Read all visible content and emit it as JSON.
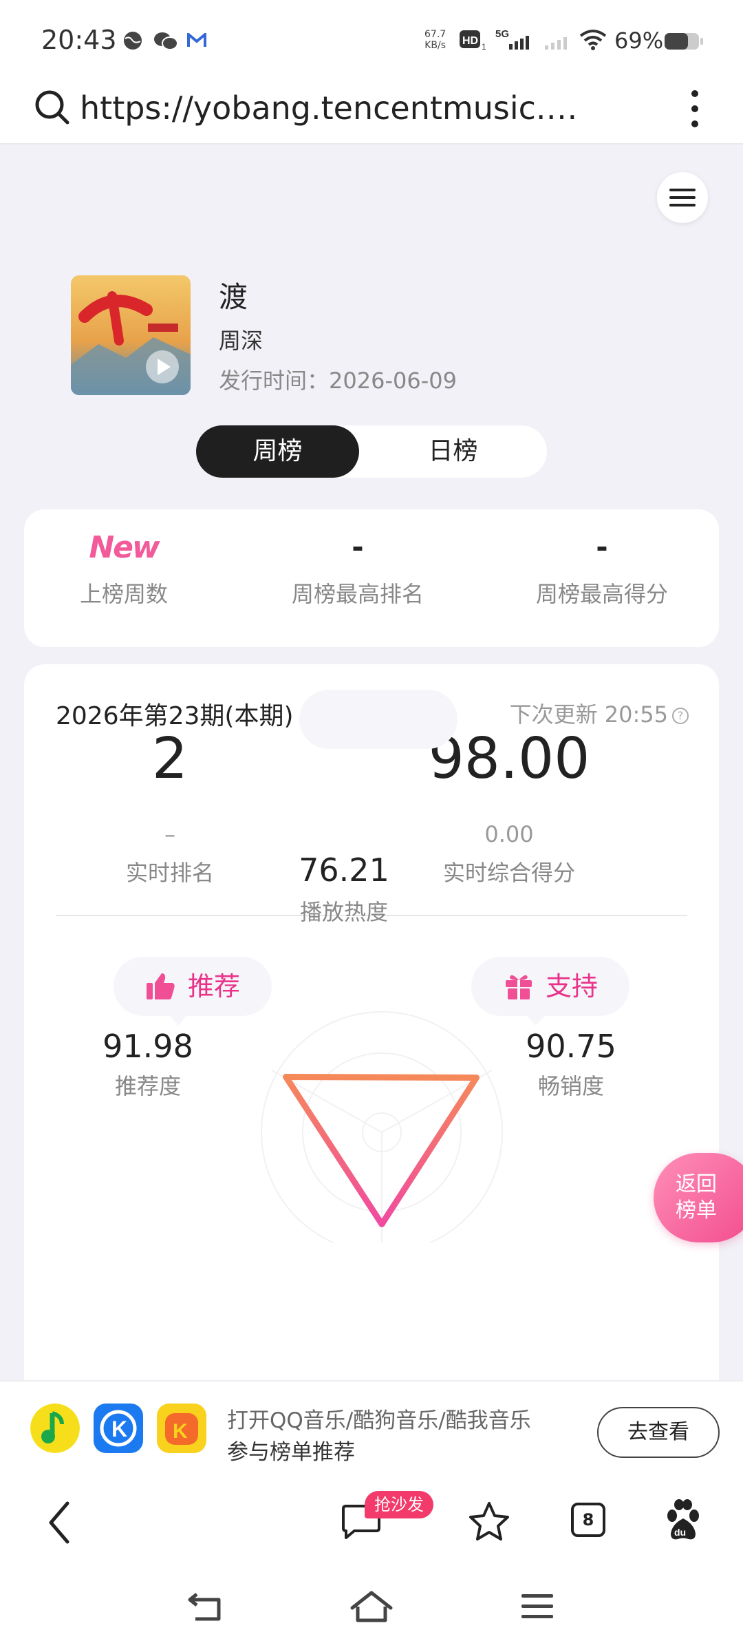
{
  "status_bar": {
    "time": "20:43",
    "net_speed_value": "67.7",
    "net_speed_unit": "KB/s",
    "battery": "69%",
    "icons": [
      "globe-icon",
      "wechat-icon",
      "mail-icon",
      "hd-icon",
      "5g-signal-icon",
      "signal-icon",
      "wifi-icon",
      "battery-icon"
    ]
  },
  "url_bar": {
    "url": "https://yobang.tencentmusic.…"
  },
  "song": {
    "title": "渡",
    "artist": "周深",
    "release_label": "发行时间：",
    "release_date": "2026-06-09"
  },
  "chart_toggle": {
    "weekly": "周榜",
    "daily": "日榜",
    "selected": "周榜"
  },
  "summary": {
    "weeks_value": "New",
    "weeks_label": "上榜周数",
    "peak_rank_value": "-",
    "peak_rank_label": "周榜最高排名",
    "peak_score_value": "-",
    "peak_score_label": "周榜最高得分"
  },
  "period": {
    "label": "2026年第23期(本期)",
    "next_update": "下次更新 20:55"
  },
  "realtime": {
    "rank": "2",
    "rank_change": "–",
    "rank_label": "实时排名",
    "score": "98.00",
    "score_change": "0.00",
    "score_label": "实时综合得分"
  },
  "metrics": {
    "recommend_pill": "推荐",
    "recommend_score": "91.98",
    "recommend_label": "推荐度",
    "support_pill": "支持",
    "support_score": "90.75",
    "support_label": "畅销度",
    "play_score": "76.21",
    "play_label": "播放热度",
    "radar_values": [
      91.98,
      90.75,
      76.21
    ],
    "colors": {
      "accent": "#e9338a",
      "orange": "#f5895a",
      "pink": "#f04aa0"
    }
  },
  "return_button": {
    "line1": "返回",
    "line2": "榜单"
  },
  "promo": {
    "line1": "打开QQ音乐/酷狗音乐/酷我音乐",
    "line2": "参与榜单推荐",
    "button": "去查看",
    "apps": [
      "qq-music-icon",
      "kugou-icon",
      "kuwo-icon"
    ]
  },
  "browser_nav": {
    "sofa_badge": "抢沙发",
    "tab_count": "8"
  }
}
